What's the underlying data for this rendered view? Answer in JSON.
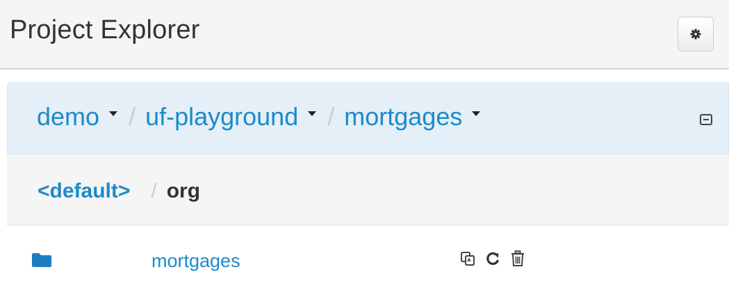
{
  "header": {
    "title": "Project Explorer",
    "settings_icon": "gear-icon"
  },
  "breadcrumb": {
    "items": [
      {
        "label": "demo"
      },
      {
        "label": "uf-playground"
      },
      {
        "label": "mortgages"
      }
    ],
    "separator": "/",
    "collapse_icon": "collapse-icon"
  },
  "path": {
    "root": "<default>",
    "separator": "/",
    "current": "org"
  },
  "rows": [
    {
      "name": "mortgages",
      "icon": "folder-icon",
      "actions": [
        "copy-icon",
        "refresh-icon",
        "trash-icon"
      ]
    }
  ],
  "colors": {
    "link": "#1d8ac9",
    "breadcrumb_bg": "#e4eff7",
    "header_bg": "#f5f5f5"
  }
}
